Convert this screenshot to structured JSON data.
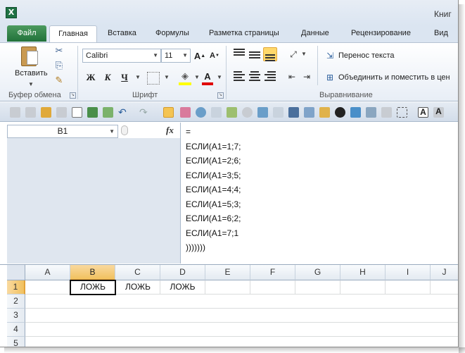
{
  "window": {
    "title": "Книг"
  },
  "tabs": [
    {
      "label": "Файл"
    },
    {
      "label": "Главная"
    },
    {
      "label": "Вставка"
    },
    {
      "label": "Формулы"
    },
    {
      "label": "Разметка страницы"
    },
    {
      "label": "Данные"
    },
    {
      "label": "Рецензирование"
    },
    {
      "label": "Вид"
    }
  ],
  "ribbon": {
    "clipboard": {
      "paste_label": "Вставить",
      "group_label": "Буфер обмена"
    },
    "font": {
      "font_name": "Calibri",
      "font_size": "11",
      "group_label": "Шрифт",
      "bold": "Ж",
      "italic": "К",
      "underline": "Ч"
    },
    "alignment": {
      "wrap_text": "Перенос текста",
      "merge_center": "Объединить и поместить в цен",
      "group_label": "Выравнивание"
    }
  },
  "formula_bar": {
    "name_box": "B1",
    "fx_label": "fx",
    "lines": [
      "=",
      "ЕСЛИ(A1=1;7;",
      "ЕСЛИ(A1=2;6;",
      "ЕСЛИ(A1=3;5;",
      "ЕСЛИ(A1=4;4;",
      "ЕСЛИ(A1=5;3;",
      "ЕСЛИ(A1=6;2;",
      "ЕСЛИ(A1=7;1",
      ")))))))"
    ]
  },
  "sheet": {
    "columns": [
      "A",
      "B",
      "C",
      "D",
      "E",
      "F",
      "G",
      "H",
      "I",
      "J"
    ],
    "selected_column": "B",
    "rows": [
      "1",
      "2",
      "3",
      "4",
      "5"
    ],
    "selected_row": "1",
    "row1": {
      "A": "",
      "B": "ЛОЖЬ",
      "C": "ЛОЖЬ",
      "D": "ЛОЖЬ"
    }
  },
  "colors": {
    "file_tab": "#21723a",
    "selection": "#f1c15f",
    "ribbon_bg": "#e8eef6"
  }
}
